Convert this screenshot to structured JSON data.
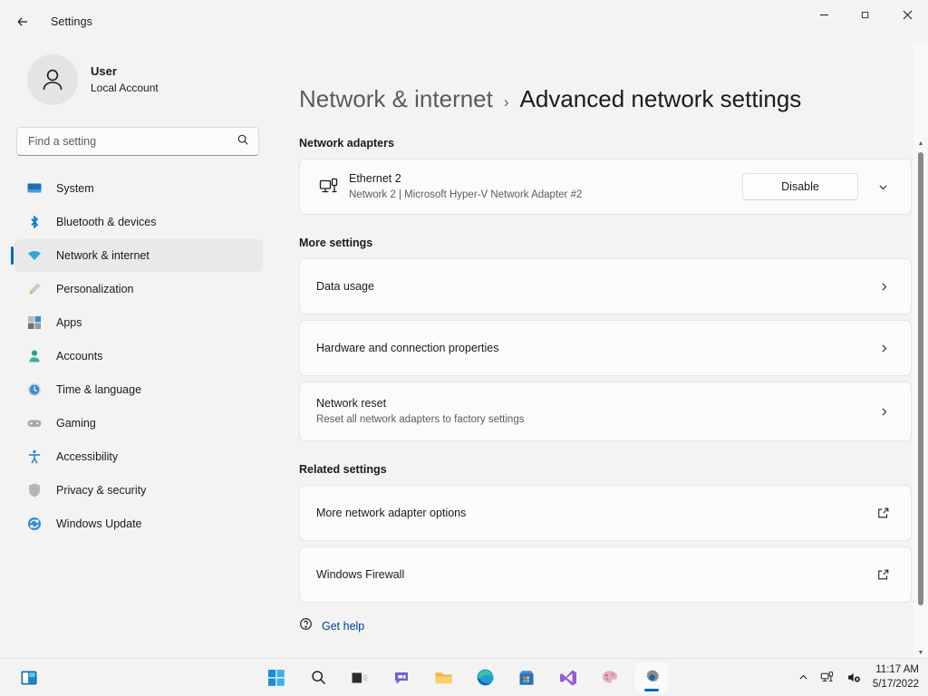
{
  "titlebar": {
    "back_icon": "arrow-left-icon",
    "app_title": "Settings",
    "minimize_label": "—",
    "maximize_label": "❐",
    "close_label": "✕"
  },
  "sidebar": {
    "account": {
      "avatar_icon": "person-avatar-icon",
      "name": "User",
      "type": "Local Account"
    },
    "search": {
      "placeholder": "Find a setting",
      "value": "",
      "icon": "search-icon"
    },
    "items": [
      {
        "label": "System",
        "icon": "system-icon",
        "selected": false
      },
      {
        "label": "Bluetooth & devices",
        "icon": "bluetooth-icon",
        "selected": false
      },
      {
        "label": "Network & internet",
        "icon": "wifi-icon",
        "selected": true
      },
      {
        "label": "Personalization",
        "icon": "paintbrush-icon",
        "selected": false
      },
      {
        "label": "Apps",
        "icon": "apps-icon",
        "selected": false
      },
      {
        "label": "Accounts",
        "icon": "accounts-icon",
        "selected": false
      },
      {
        "label": "Time & language",
        "icon": "clock-icon",
        "selected": false
      },
      {
        "label": "Gaming",
        "icon": "gamepad-icon",
        "selected": false
      },
      {
        "label": "Accessibility",
        "icon": "accessibility-icon",
        "selected": false
      },
      {
        "label": "Privacy & security",
        "icon": "shield-icon",
        "selected": false
      },
      {
        "label": "Windows Update",
        "icon": "update-icon",
        "selected": false
      }
    ]
  },
  "content": {
    "breadcrumb": {
      "parent": "Network & internet",
      "separator": "›",
      "current": "Advanced network settings"
    },
    "network_adapters": {
      "section_title": "Network adapters",
      "adapter": {
        "icon": "ethernet-adapter-icon",
        "name": "Ethernet 2",
        "subtitle": "Network 2 | Microsoft Hyper-V Network Adapter #2",
        "button_label": "Disable",
        "expand_icon": "chevron-down-icon"
      }
    },
    "more_settings": {
      "section_title": "More settings",
      "rows": [
        {
          "title": "Data usage",
          "subtitle": "",
          "affordance": "chevron-right-icon"
        },
        {
          "title": "Hardware and connection properties",
          "subtitle": "",
          "affordance": "chevron-right-icon"
        },
        {
          "title": "Network reset",
          "subtitle": "Reset all network adapters to factory settings",
          "affordance": "chevron-right-icon"
        }
      ]
    },
    "related_settings": {
      "section_title": "Related settings",
      "rows": [
        {
          "title": "More network adapter options",
          "subtitle": "",
          "affordance": "open-external-icon"
        },
        {
          "title": "Windows Firewall",
          "subtitle": "",
          "affordance": "open-external-icon"
        }
      ]
    },
    "get_help": {
      "label": "Get help",
      "icon": "help-icon"
    },
    "scrollbar": {
      "up_icon": "scroll-up-arrow-icon",
      "down_icon": "scroll-down-arrow-icon"
    }
  },
  "taskbar": {
    "widgets_icon": "widgets-icon",
    "items": [
      {
        "name": "start",
        "icon": "windows-start-icon",
        "active": false
      },
      {
        "name": "search",
        "icon": "search-icon",
        "active": false
      },
      {
        "name": "task-view",
        "icon": "task-view-icon",
        "active": false
      },
      {
        "name": "chat",
        "icon": "chat-icon",
        "active": false
      },
      {
        "name": "file-explorer",
        "icon": "folder-icon",
        "active": false
      },
      {
        "name": "edge",
        "icon": "edge-icon",
        "active": false
      },
      {
        "name": "microsoft-store",
        "icon": "store-icon",
        "active": false
      },
      {
        "name": "visual-studio",
        "icon": "visual-studio-icon",
        "active": false
      },
      {
        "name": "paint",
        "icon": "paint-icon",
        "active": false
      },
      {
        "name": "settings",
        "icon": "gear-icon",
        "active": true
      }
    ],
    "tray": {
      "chevron_icon": "chevron-up-icon",
      "network_icon": "ethernet-tray-icon",
      "volume_icon": "speaker-muted-icon",
      "time": "11:17 AM",
      "date": "5/17/2022"
    }
  },
  "colors": {
    "accent": "#0067c0",
    "page_bg": "#f3f3f3",
    "card_bg": "#fbfbfb",
    "link": "#003e92"
  }
}
